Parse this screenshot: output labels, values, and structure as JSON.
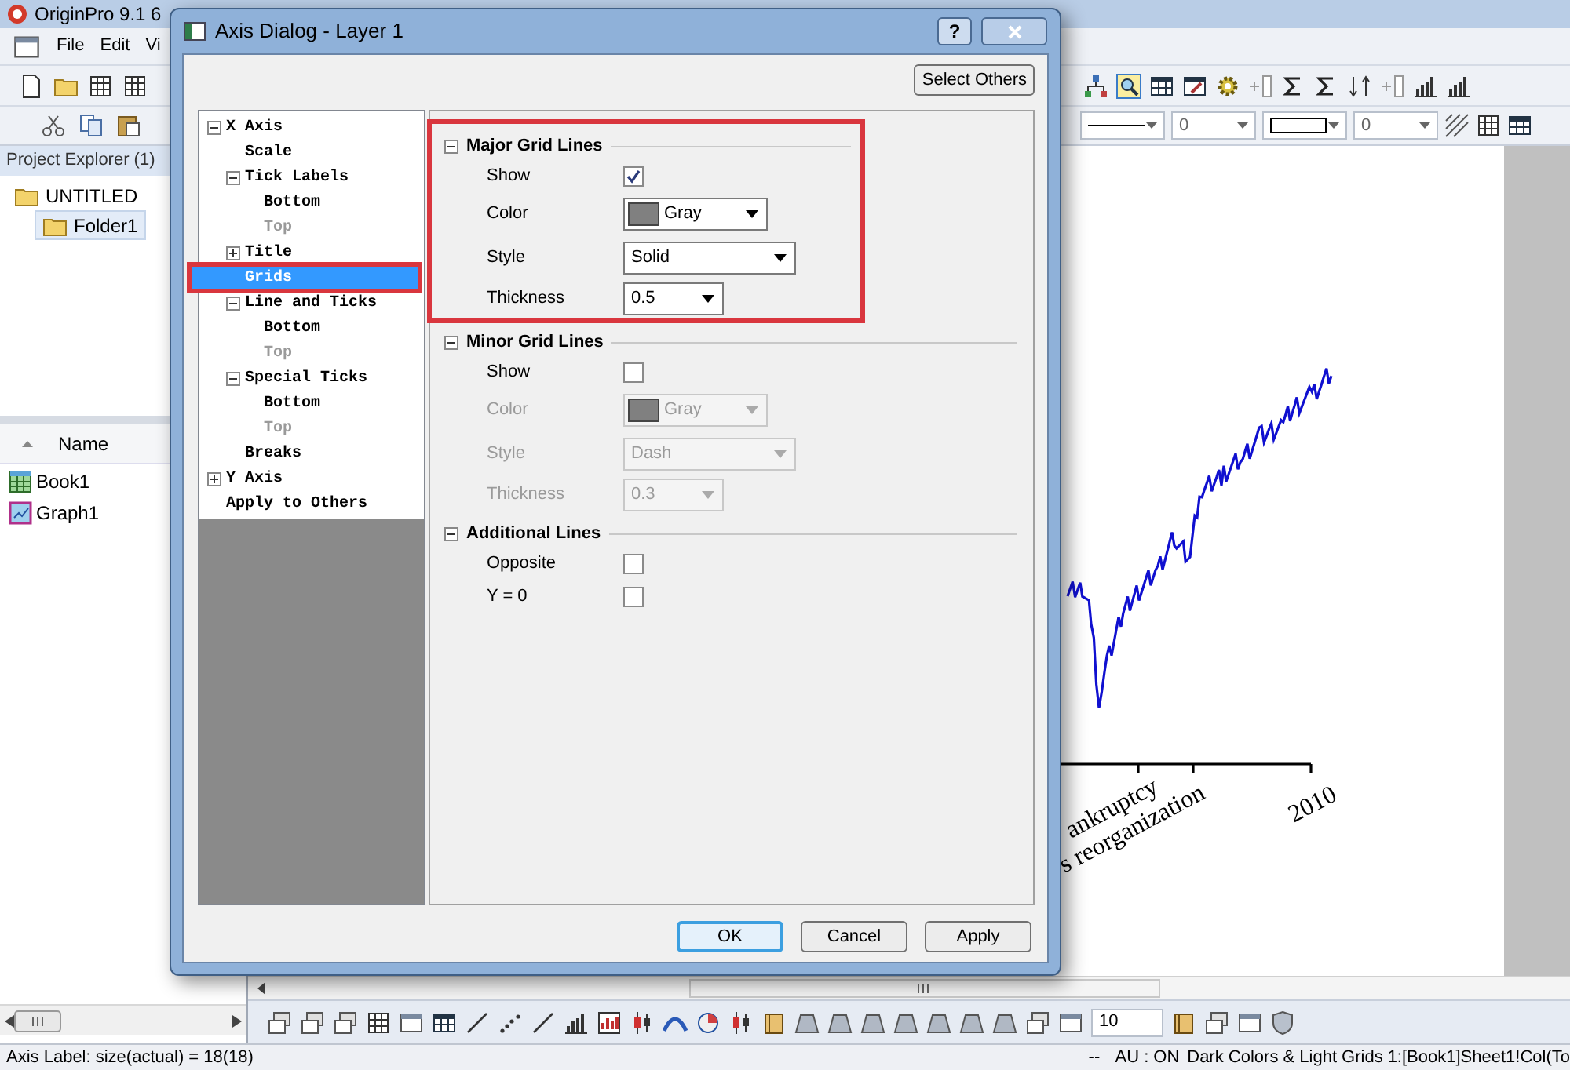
{
  "app": {
    "title": "OriginPro 9.1 6",
    "menu": [
      "File",
      "Edit",
      "Vi"
    ]
  },
  "format_toolbar": {
    "dropdowns": [
      {
        "kind": "line"
      },
      {
        "kind": "text",
        "value": "0"
      },
      {
        "kind": "rect"
      },
      {
        "kind": "text",
        "value": "0"
      }
    ]
  },
  "project_explorer": {
    "title": "Project Explorer (1)",
    "folders": [
      {
        "label": "UNTITLED",
        "selected": false,
        "children": [
          {
            "label": "Folder1",
            "selected": true
          }
        ]
      }
    ],
    "column": "Name",
    "items": [
      {
        "label": "Book1",
        "kind": "workbook"
      },
      {
        "label": "Graph1",
        "kind": "graph"
      }
    ]
  },
  "graph": {
    "tick_labels": [
      "ankruptcy",
      "s reorganization",
      "2010"
    ]
  },
  "dialog": {
    "title": "Axis Dialog - Layer 1",
    "help": "?",
    "select_others": "Select Others",
    "tree": [
      {
        "label": "X Axis",
        "expanded": true,
        "selected": false,
        "disabled": false,
        "highlighted": false,
        "children": [
          {
            "label": "Scale",
            "selected": false,
            "disabled": false,
            "highlighted": false
          },
          {
            "label": "Tick Labels",
            "expanded": true,
            "selected": false,
            "disabled": false,
            "highlighted": false,
            "children": [
              {
                "label": "Bottom",
                "selected": false,
                "disabled": false,
                "highlighted": false
              },
              {
                "label": "Top",
                "selected": false,
                "disabled": true,
                "highlighted": false
              }
            ]
          },
          {
            "label": "Title",
            "expanded": false,
            "selected": false,
            "disabled": false,
            "highlighted": false
          },
          {
            "label": "Grids",
            "selected": true,
            "disabled": false,
            "highlighted": true
          },
          {
            "label": "Line and Ticks",
            "expanded": true,
            "selected": false,
            "disabled": false,
            "highlighted": false,
            "children": [
              {
                "label": "Bottom",
                "selected": false,
                "disabled": false,
                "highlighted": false
              },
              {
                "label": "Top",
                "selected": false,
                "disabled": true,
                "highlighted": false
              }
            ]
          },
          {
            "label": "Special Ticks",
            "expanded": true,
            "selected": false,
            "disabled": false,
            "highlighted": false,
            "children": [
              {
                "label": "Bottom",
                "selected": false,
                "disabled": false,
                "highlighted": false
              },
              {
                "label": "Top",
                "selected": false,
                "disabled": true,
                "highlighted": false
              }
            ]
          },
          {
            "label": "Breaks",
            "selected": false,
            "disabled": false,
            "highlighted": false
          }
        ]
      },
      {
        "label": "Y Axis",
        "expanded": false,
        "selected": false,
        "disabled": false,
        "highlighted": false
      },
      {
        "label": "Apply to Others",
        "selected": false,
        "disabled": false,
        "highlighted": false
      }
    ],
    "sections": [
      {
        "title": "Major Grid Lines",
        "expanded": true,
        "highlighted": true,
        "rows": [
          {
            "kind": "checkbox",
            "label": "Show",
            "checked": true,
            "disabled": false
          },
          {
            "kind": "color",
            "label": "Color",
            "value": "Gray",
            "disabled": false
          },
          {
            "kind": "select",
            "label": "Style",
            "value": "Solid",
            "disabled": false
          },
          {
            "kind": "combo",
            "label": "Thickness",
            "value": "0.5",
            "disabled": false
          }
        ]
      },
      {
        "title": "Minor Grid Lines",
        "expanded": true,
        "highlighted": false,
        "rows": [
          {
            "kind": "checkbox",
            "label": "Show",
            "checked": false,
            "disabled": false
          },
          {
            "kind": "color",
            "label": "Color",
            "value": "Gray",
            "disabled": true
          },
          {
            "kind": "select",
            "label": "Style",
            "value": "Dash",
            "disabled": true
          },
          {
            "kind": "combo",
            "label": "Thickness",
            "value": "0.3",
            "disabled": true
          }
        ]
      },
      {
        "title": "Additional Lines",
        "expanded": true,
        "highlighted": false,
        "rows": [
          {
            "kind": "checkbox",
            "label": "Opposite",
            "checked": false,
            "disabled": false
          },
          {
            "kind": "checkbox",
            "label": "Y = 0",
            "checked": false,
            "disabled": false
          }
        ]
      }
    ],
    "buttons": [
      {
        "label": "OK",
        "default": true
      },
      {
        "label": "Cancel",
        "default": false
      },
      {
        "label": "Apply",
        "default": false
      }
    ]
  },
  "bottom_toolbar": {
    "field_value": "10"
  },
  "status_bar": [
    "Axis Label: size(actual) = 18(18)",
    "--",
    "AU : ON",
    "Dark Colors & Light Grids",
    "1:[Book1]Sheet1!Col(To"
  ]
}
